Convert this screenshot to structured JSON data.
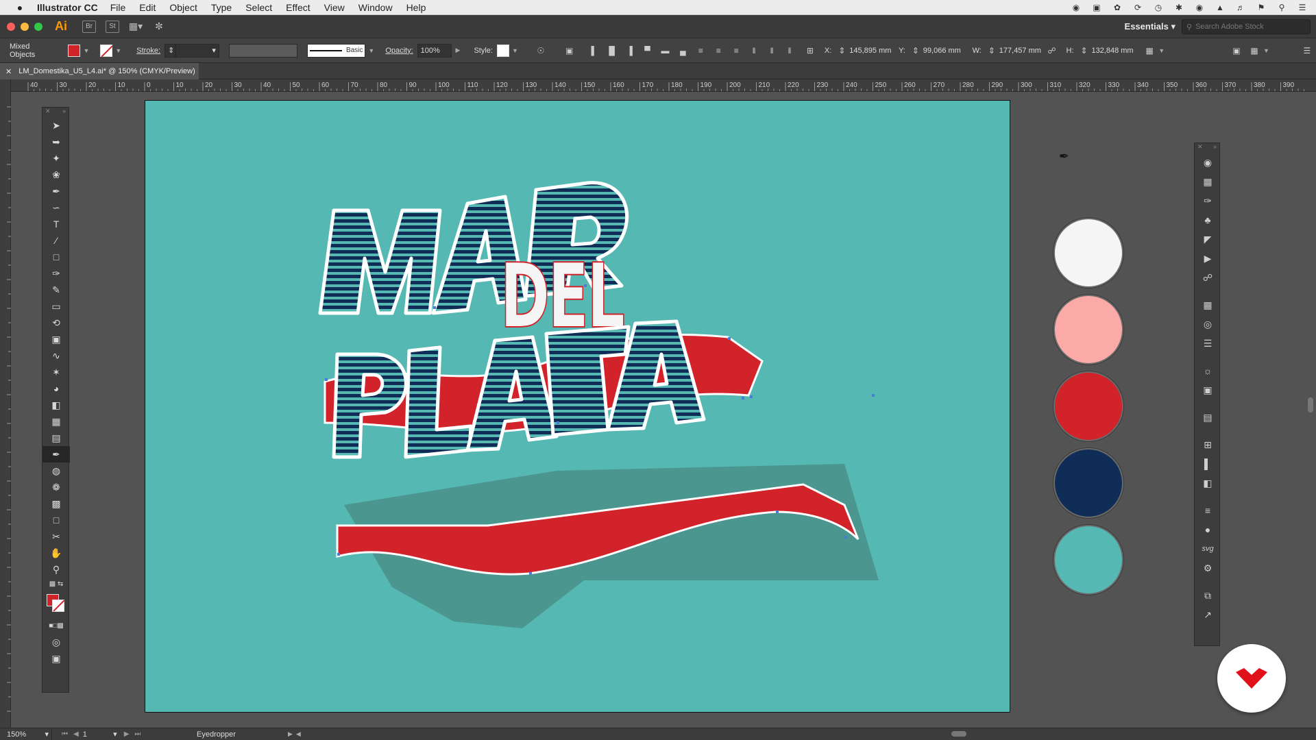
{
  "menubar": {
    "app_name": "Illustrator CC",
    "items": [
      "File",
      "Edit",
      "Object",
      "Type",
      "Select",
      "Effect",
      "View",
      "Window",
      "Help"
    ]
  },
  "appbar": {
    "logo": "Ai",
    "bridge": "Br",
    "stock": "St",
    "workspace": "Essentials",
    "search_placeholder": "Search Adobe Stock"
  },
  "control": {
    "selection": "Mixed Objects",
    "stroke_label": "Stroke:",
    "brush": "Basic",
    "opacity_label": "Opacity:",
    "opacity_value": "100%",
    "style_label": "Style:",
    "x_label": "X:",
    "x_value": "145,895 mm",
    "y_label": "Y:",
    "y_value": "99,066 mm",
    "w_label": "W:",
    "w_value": "177,457 mm",
    "h_label": "H:",
    "h_value": "132,848 mm"
  },
  "document": {
    "tab_title": "LM_Domestika_U5_L4.ai* @ 150% (CMYK/Preview)"
  },
  "ruler_labels": [
    "40",
    "30",
    "20",
    "10",
    "0",
    "10",
    "20",
    "30",
    "40",
    "50",
    "60",
    "70",
    "80",
    "90",
    "100",
    "110",
    "120",
    "130",
    "140",
    "150",
    "160",
    "170",
    "180",
    "190",
    "200",
    "210",
    "220",
    "230",
    "240",
    "250",
    "260",
    "270",
    "280",
    "290",
    "300",
    "310",
    "320",
    "330",
    "340",
    "350",
    "360",
    "370",
    "380",
    "390"
  ],
  "artwork": {
    "line1": "MAR",
    "line2": "DEL",
    "line3": "PLATA"
  },
  "palette": [
    "#f5f5f5",
    "#fcaaa7",
    "#d2232a",
    "#0f2d57",
    "#56b8b3"
  ],
  "status": {
    "zoom": "150%",
    "page": "1",
    "tool": "Eyedropper"
  }
}
